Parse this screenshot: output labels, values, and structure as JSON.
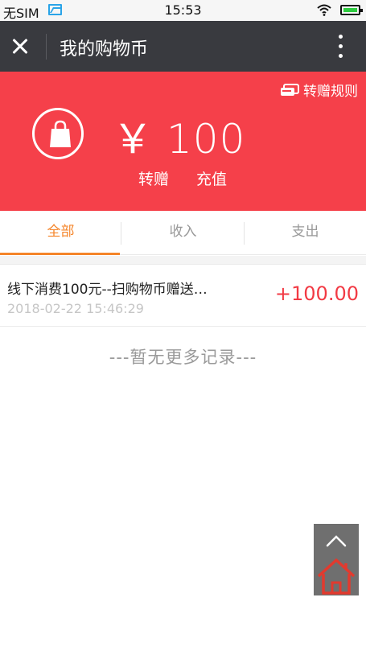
{
  "status_bar": {
    "carrier": "无SIM",
    "time": "15:53"
  },
  "header": {
    "title": "我的购物币"
  },
  "balance": {
    "rules_label": "转赠规则",
    "currency_symbol": "￥",
    "amount": "100",
    "transfer_label": "转赠",
    "recharge_label": "充值"
  },
  "tabs": [
    {
      "label": "全部",
      "active": true
    },
    {
      "label": "收入",
      "active": false
    },
    {
      "label": "支出",
      "active": false
    }
  ],
  "records": [
    {
      "description": "线下消费100元--扫购物币赠送…",
      "time": "2018-02-22 15:46:29",
      "amount": "+100.00"
    }
  ],
  "empty_hint": "---暂无更多记录---",
  "colors": {
    "accent_red": "#f5404a",
    "tab_active": "#f5852a",
    "header_bg": "#393a3f",
    "home_icon": "#e23a2e"
  }
}
